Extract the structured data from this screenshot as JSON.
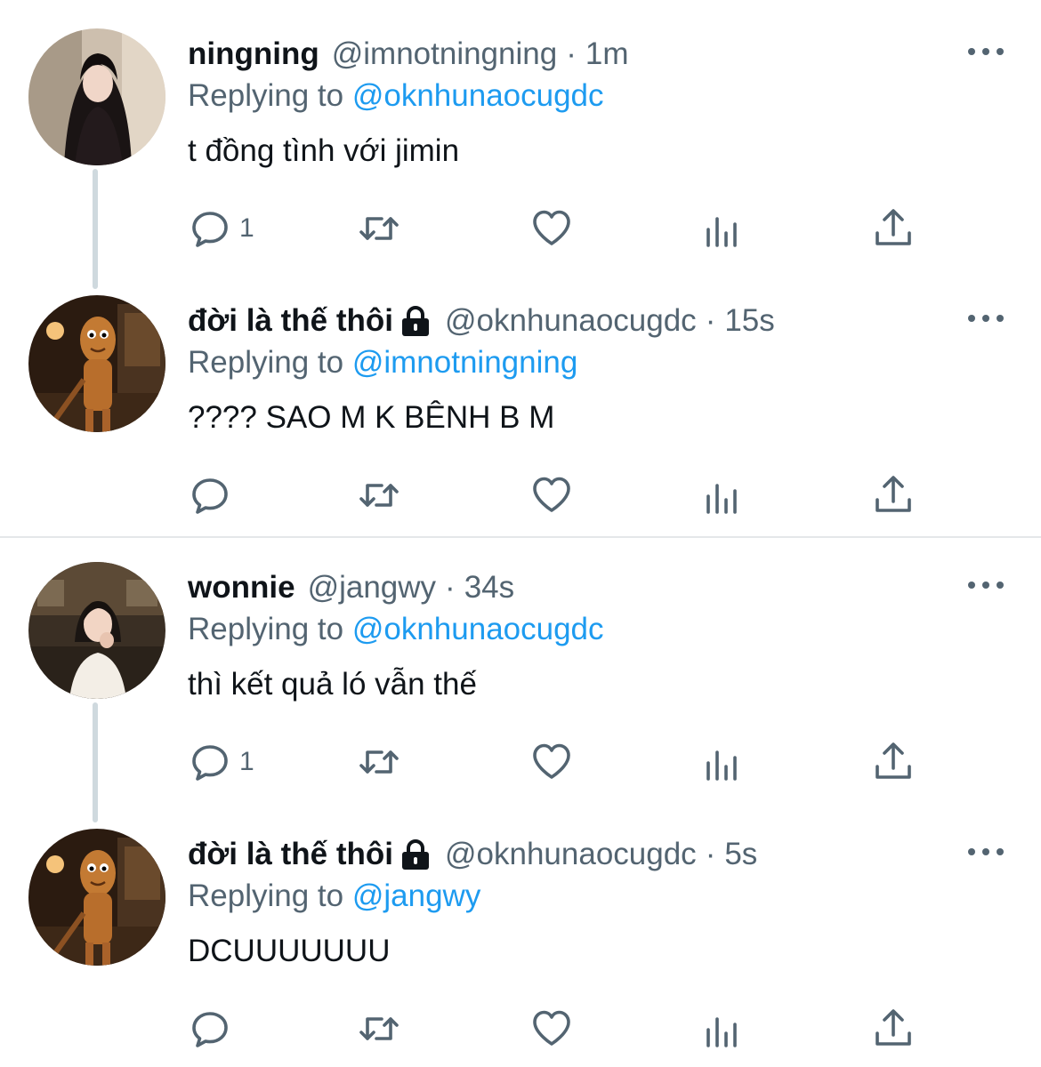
{
  "colors": {
    "accent": "#1d9bf0",
    "muted": "#536471",
    "text": "#0f1419"
  },
  "replying_label": "Replying to",
  "tweets": [
    {
      "name": "ningning",
      "locked": false,
      "handle": "@imnotningning",
      "separator": "·",
      "time": "1m",
      "replying_to": "@oknhunaocugdc",
      "text": "t đồng tình với jimin",
      "reply_count": "1",
      "avatar": "girl-dark-hair"
    },
    {
      "name": "đời là thế thôi",
      "locked": true,
      "handle": "@oknhunaocugdc",
      "separator": "·",
      "time": "15s",
      "replying_to": "@imnotningning",
      "text": "???? SAO M K BÊNH B M",
      "reply_count": "",
      "avatar": "wooden-character"
    },
    {
      "name": "wonnie",
      "locked": false,
      "handle": "@jangwy",
      "separator": "·",
      "time": "34s",
      "replying_to": "@oknhunaocugdc",
      "text": "thì kết quả ló vẫn thế",
      "reply_count": "1",
      "avatar": "girl-cafe"
    },
    {
      "name": "đời là thế thôi",
      "locked": true,
      "handle": "@oknhunaocugdc",
      "separator": "·",
      "time": "5s",
      "replying_to": "@jangwy",
      "text": "DCUUUUUUU",
      "reply_count": "",
      "avatar": "wooden-character"
    }
  ]
}
